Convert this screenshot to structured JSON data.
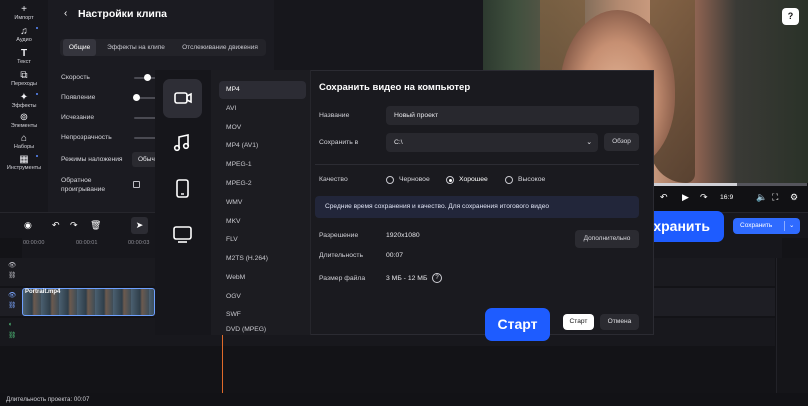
{
  "sidebar": {
    "items": [
      {
        "label": "Импорт",
        "icon": "plus-icon"
      },
      {
        "label": "Аудио",
        "icon": "music-note-icon"
      },
      {
        "label": "Текст",
        "icon": "text-icon"
      },
      {
        "label": "Переходы",
        "icon": "transitions-icon"
      },
      {
        "label": "Эффекты",
        "icon": "sparkle-icon"
      },
      {
        "label": "Элементы",
        "icon": "elements-icon"
      },
      {
        "label": "Наборы",
        "icon": "kits-icon"
      },
      {
        "label": "Инструменты",
        "icon": "tools-icon"
      }
    ]
  },
  "settings": {
    "title": "Настройки клипа",
    "tabs": [
      "Общие",
      "Эффекты на клипе",
      "Отслеживание движения"
    ],
    "props": {
      "speed": "Скорость",
      "appearance": "Появление",
      "fade": "Исчезание",
      "opacity": "Непрозрачность",
      "blend": "Режимы наложения",
      "blend_value": "Обыч",
      "reverse_line1": "Обратное",
      "reverse_line2": "проигрывание"
    }
  },
  "player": {
    "aspect": "16:9",
    "save_label": "Сохранить"
  },
  "callouts": {
    "save": "Сохранить",
    "start": "Старт"
  },
  "timeline": {
    "ticks": [
      "00:00:00",
      "00:00:01",
      "00:00:03"
    ],
    "clip_name": "Portrait.mp4"
  },
  "status": {
    "duration": "Длительность проекта: 00:07"
  },
  "modal": {
    "title": "Сохранить видео на компьютер",
    "formats": [
      "MP4",
      "AVI",
      "MOV",
      "MP4 (AV1)",
      "MPEG-1",
      "MPEG-2",
      "WMV",
      "MKV",
      "FLV",
      "M2TS (H.264)",
      "WebM",
      "OGV",
      "SWF",
      "DVD (MPEG)"
    ],
    "name_label": "Название",
    "name_value": "Новый проект",
    "save_in_label": "Сохранить в",
    "save_in_value": "C:\\",
    "browse": "Обзор",
    "quality_label": "Качество",
    "quality_options": [
      "Черновое",
      "Хорошее",
      "Высокое"
    ],
    "quality_selected": "Хорошее",
    "info": "Средние время сохранения и качество. Для сохранения итогового видео",
    "resolution_label": "Разрешение",
    "resolution_value": "1920x1080",
    "more": "Дополнительно",
    "duration_label": "Длительность",
    "duration_value": "00:07",
    "filesize_label": "Размер файла",
    "filesize_value": "3 МБ - 12 МБ",
    "start": "Старт",
    "cancel": "Отмена"
  },
  "colors": {
    "accent": "#2f6bff",
    "callout": "#1e5cff",
    "playhead": "#e06a2a"
  }
}
